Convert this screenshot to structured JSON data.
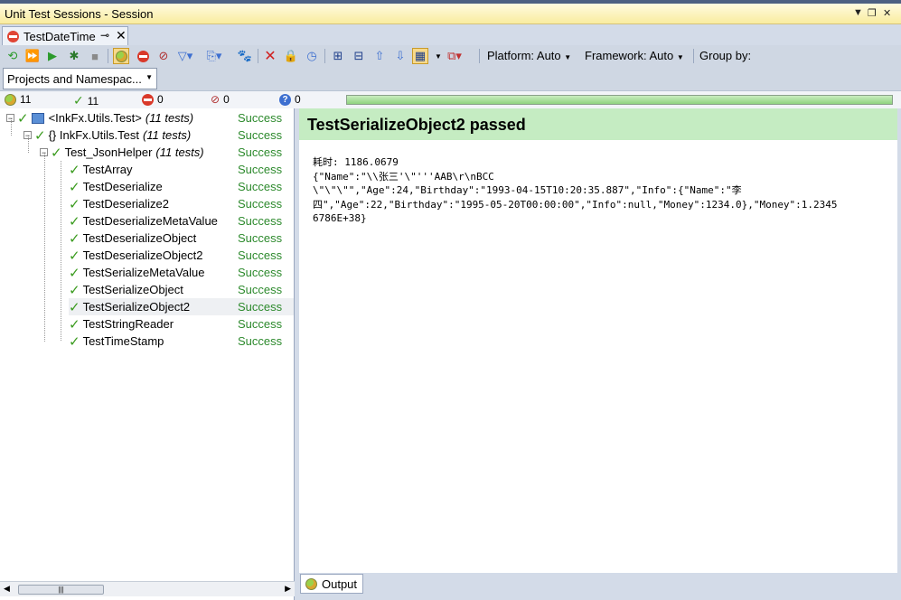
{
  "window": {
    "title": "Unit Test Sessions - Session",
    "controls": {
      "menu": "▼",
      "restore": "❐",
      "close": "✕"
    }
  },
  "tab": {
    "label": "TestDateTime",
    "pin": "⊸",
    "close": "✕"
  },
  "toolbar": {
    "platform_label": "Platform: Auto",
    "framework_label": "Framework: Auto",
    "group_by_label": "Group by:"
  },
  "group_combo": {
    "value": "Projects and Namespac..."
  },
  "stats": {
    "total": "11",
    "passed": "11",
    "failed": "0",
    "ignored": "0",
    "unknown": "0",
    "progress": 1.0
  },
  "tree": [
    {
      "label": "<InkFx.Utils.Test>",
      "sub": "(11 tests)",
      "status": "Success",
      "kind": "project"
    },
    {
      "label": "{} InkFx.Utils.Test",
      "sub": "(11 tests)",
      "status": "Success",
      "kind": "namespace"
    },
    {
      "label": "Test_JsonHelper",
      "sub": "(11 tests)",
      "status": "Success",
      "kind": "class"
    },
    {
      "label": "TestArray",
      "status": "Success"
    },
    {
      "label": "TestDeserialize",
      "status": "Success"
    },
    {
      "label": "TestDeserialize2",
      "status": "Success"
    },
    {
      "label": "TestDeserializeMetaValue",
      "status": "Success"
    },
    {
      "label": "TestDeserializeObject",
      "status": "Success"
    },
    {
      "label": "TestDeserializeObject2",
      "status": "Success"
    },
    {
      "label": "TestSerializeMetaValue",
      "status": "Success"
    },
    {
      "label": "TestSerializeObject",
      "status": "Success"
    },
    {
      "label": "TestSerializeObject2",
      "status": "Success"
    },
    {
      "label": "TestStringReader",
      "status": "Success"
    },
    {
      "label": "TestTimeStamp",
      "status": "Success"
    }
  ],
  "result": {
    "title": "TestSerializeObject2 passed",
    "output": [
      "耗时: 1186.0679",
      "{\"Name\":\"\\\\张三'\\\"'''AAB\\r\\nBCC",
      "\\\"\\\"\\\"\",\"Age\":24,\"Birthday\":\"1993-04-15T10:20:35.887\",\"Info\":{\"Name\":\"李",
      "四\",\"Age\":22,\"Birthday\":\"1995-05-20T00:00:00\",\"Info\":null,\"Money\":1234.0},\"Money\":1.2345",
      "6786E+38}"
    ]
  },
  "output_tab": {
    "label": "Output"
  }
}
